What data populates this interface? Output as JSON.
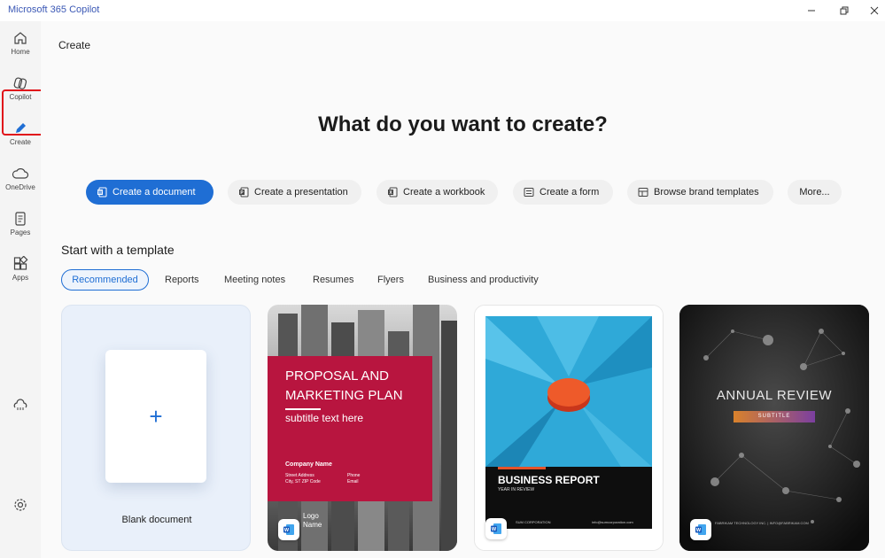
{
  "app": {
    "title": "Microsoft 365 Copilot"
  },
  "window": {
    "minimize_icon": "minimize-icon",
    "restore_icon": "restore-icon",
    "close_icon": "close-icon"
  },
  "sidebar": {
    "items": [
      {
        "label": "Home",
        "icon": "home-icon"
      },
      {
        "label": "Copilot",
        "icon": "copilot-icon"
      },
      {
        "label": "Create",
        "icon": "pen-icon",
        "active": true
      },
      {
        "label": "OneDrive",
        "icon": "cloud-icon"
      },
      {
        "label": "Pages",
        "icon": "pages-icon"
      },
      {
        "label": "Apps",
        "icon": "apps-icon"
      }
    ],
    "extra_icon": "cloud-network-icon",
    "settings_icon": "gear-icon",
    "highlight_color": "#e0121a"
  },
  "main": {
    "breadcrumb": "Create",
    "headline": "What do you want to create?",
    "actions": [
      {
        "label": "Create a document",
        "icon": "word-icon",
        "primary": true
      },
      {
        "label": "Create a presentation",
        "icon": "powerpoint-icon"
      },
      {
        "label": "Create a workbook",
        "icon": "excel-icon"
      },
      {
        "label": "Create a form",
        "icon": "form-icon"
      },
      {
        "label": "Browse brand templates",
        "icon": "template-icon"
      },
      {
        "label": "More...",
        "icon": ""
      }
    ],
    "section_title": "Start with a template",
    "tabs": [
      "Recommended",
      "Reports",
      "Meeting notes",
      "Resumes",
      "Flyers",
      "Business and productivity"
    ],
    "active_tab": "Recommended",
    "templates": {
      "blank": {
        "label": "Blank document"
      },
      "proposal": {
        "title_line1": "PROPOSAL AND",
        "title_line2": "MARKETING PLAN",
        "subtitle": "subtitle text here",
        "company": "Company Name",
        "address1": "Street Address",
        "address2": "City, ST ZIP Code",
        "phone": "Phone",
        "email": "Email",
        "logo1": "Logo",
        "logo2": "Name"
      },
      "business_report": {
        "title": "BUSINESS REPORT",
        "subtitle": "YEAR IN REVIEW",
        "footer_left": "SUM CORPORATION",
        "footer_right": "info@sumcorporation.com"
      },
      "annual_review": {
        "title": "ANNUAL REVIEW",
        "subtitle": "SUBTITLE",
        "footer": "FABRIKAM TECHNOLOGY INC. | INFO@FABRIKAM.COM"
      }
    },
    "accent": "#1f6ed4"
  }
}
